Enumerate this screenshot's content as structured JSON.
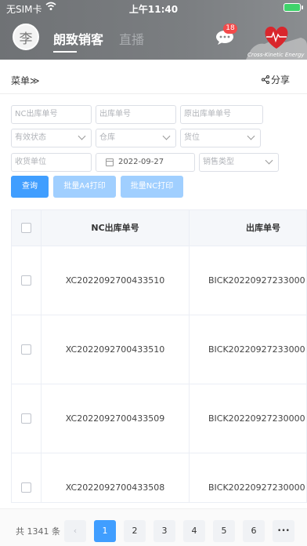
{
  "status_bar": {
    "carrier": "无SIM卡",
    "time": "上午11:40"
  },
  "header": {
    "avatar_text": "李",
    "tabs": [
      {
        "label": "朗致销客"
      },
      {
        "label": "直播"
      }
    ],
    "message_badge": "18",
    "brand_text": "Cross-Kinetic Energy"
  },
  "toolbar": {
    "menu_label": "菜单",
    "menu_glyph": "≫",
    "share_label": "分享"
  },
  "filters": {
    "nc_order_placeholder": "NC出库单号",
    "out_order_placeholder": "出库单号",
    "orig_order_placeholder": "原出库单单号",
    "status_placeholder": "有效状态",
    "warehouse_placeholder": "仓库",
    "location_placeholder": "货位",
    "receiver_placeholder": "收货单位",
    "date_value": "2022-09-27",
    "sale_type_placeholder": "销售类型"
  },
  "actions": {
    "query_label": "查询",
    "print_a4_label": "批量A4打印",
    "print_nc_label": "批量NC打印"
  },
  "table": {
    "columns": [
      "NC出库单号",
      "出库单号"
    ],
    "rows": [
      {
        "nc": "XC2022092700433510",
        "out": "BICK20220927233000"
      },
      {
        "nc": "XC2022092700433510",
        "out": "BICK20220927233000"
      },
      {
        "nc": "XC2022092700433509",
        "out": "BICK20220927230000"
      },
      {
        "nc": "XC2022092700433508",
        "out": "BICK20220927230000"
      }
    ]
  },
  "pagination": {
    "total_label": "共 1341 条",
    "prev": "‹",
    "pages": [
      "1",
      "2",
      "3",
      "4",
      "5",
      "6"
    ],
    "more": "•••",
    "current": "1"
  },
  "colors": {
    "primary": "#409eff",
    "primary_disabled": "#a0cfff",
    "badge": "#f34a4a",
    "header_bg": "#777a7d"
  }
}
